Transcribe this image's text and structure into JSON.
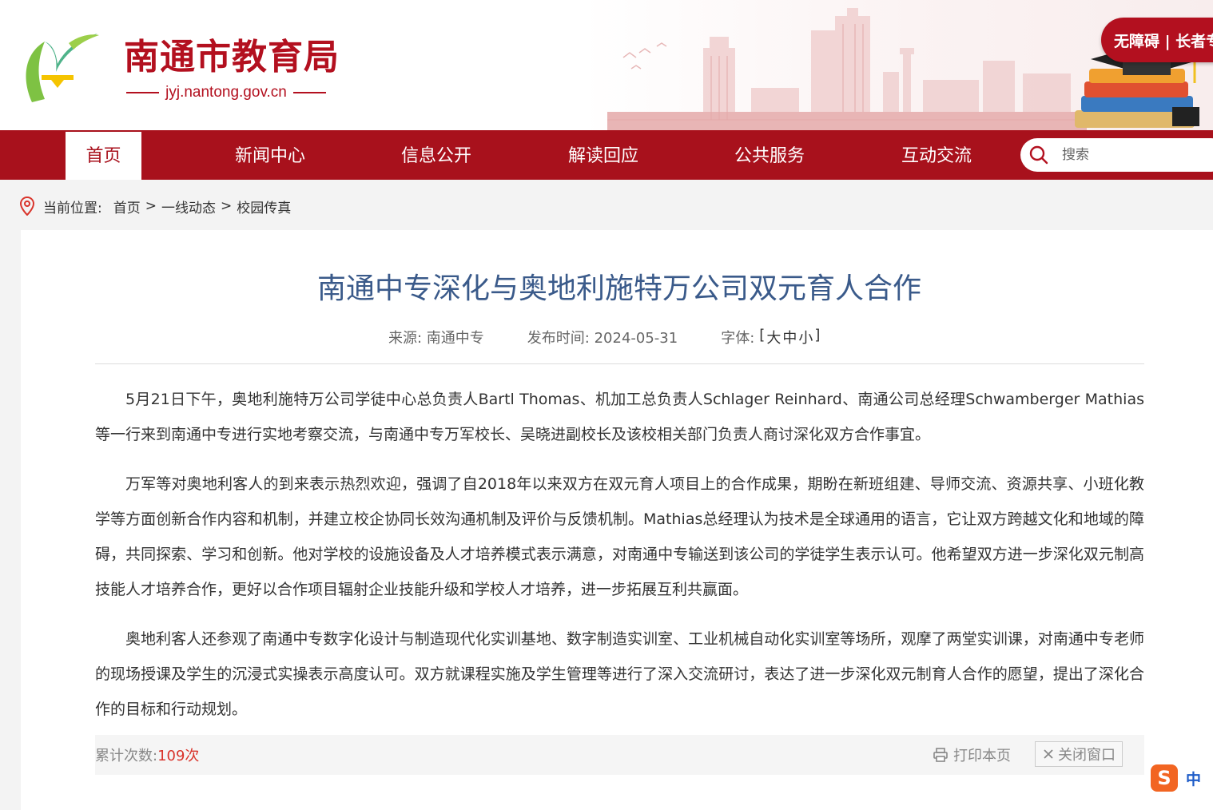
{
  "header": {
    "site_title": "南通市教育局",
    "site_domain": "jyj.nantong.gov.cn",
    "accessibility_label": "无障碍 | 长者专",
    "brand_color": "#b3101f"
  },
  "nav": {
    "items": [
      {
        "label": "首页",
        "active": true
      },
      {
        "label": "新闻中心"
      },
      {
        "label": "信息公开"
      },
      {
        "label": "解读回应"
      },
      {
        "label": "公共服务"
      },
      {
        "label": "互动交流"
      }
    ],
    "search_placeholder": "搜索",
    "bg_color": "#a8111c"
  },
  "breadcrumb": {
    "label": "当前位置:",
    "items": [
      "首页",
      "一线动态",
      "校园传真"
    ],
    "separator": ">"
  },
  "article": {
    "title": "南通中专深化与奥地利施特万公司双元育人合作",
    "source": "来源: 南通中专",
    "publish_time": "发布时间: 2024-05-31",
    "font_label": "字体:",
    "font_open": "[",
    "font_large": "大",
    "font_medium": "中",
    "font_small": "小",
    "font_close": "]",
    "paragraphs": [
      "5月21日下午，奥地利施特万公司学徒中心总负责人Bartl Thomas、机加工总负责人Schlager Reinhard、南通公司总经理Schwamberger Mathias等一行来到南通中专进行实地考察交流，与南通中专万军校长、吴晓进副校长及该校相关部门负责人商讨深化双方合作事宜。",
      "万军等对奥地利客人的到来表示热烈欢迎，强调了自2018年以来双方在双元育人项目上的合作成果，期盼在新班组建、导师交流、资源共享、小班化教学等方面创新合作内容和机制，并建立校企协同长效沟通机制及评价与反馈机制。Mathias总经理认为技术是全球通用的语言，它让双方跨越文化和地域的障碍，共同探索、学习和创新。他对学校的设施设备及人才培养模式表示满意，对南通中专输送到该公司的学徒学生表示认可。他希望双方进一步深化双元制高技能人才培养合作，更好以合作项目辐射企业技能升级和学校人才培养，进一步拓展互利共赢面。",
      "奥地利客人还参观了南通中专数字化设计与制造现代化实训基地、数字制造实训室、工业机械自动化实训室等场所，观摩了两堂实训课，对南通中专老师的现场授课及学生的沉浸式实操表示高度认可。双方就课程实施及学生管理等进行了深入交流研讨，表达了进一步深化双元制育人合作的愿望，提出了深化合作的目标和行动规划。"
    ],
    "visits_label": "累计次数:",
    "visits_count": "109次",
    "print_label": "打印本页",
    "close_label": "关闭窗口",
    "title_color": "#3a5a8a"
  },
  "ime": {
    "logo": "S",
    "lang": "中"
  }
}
